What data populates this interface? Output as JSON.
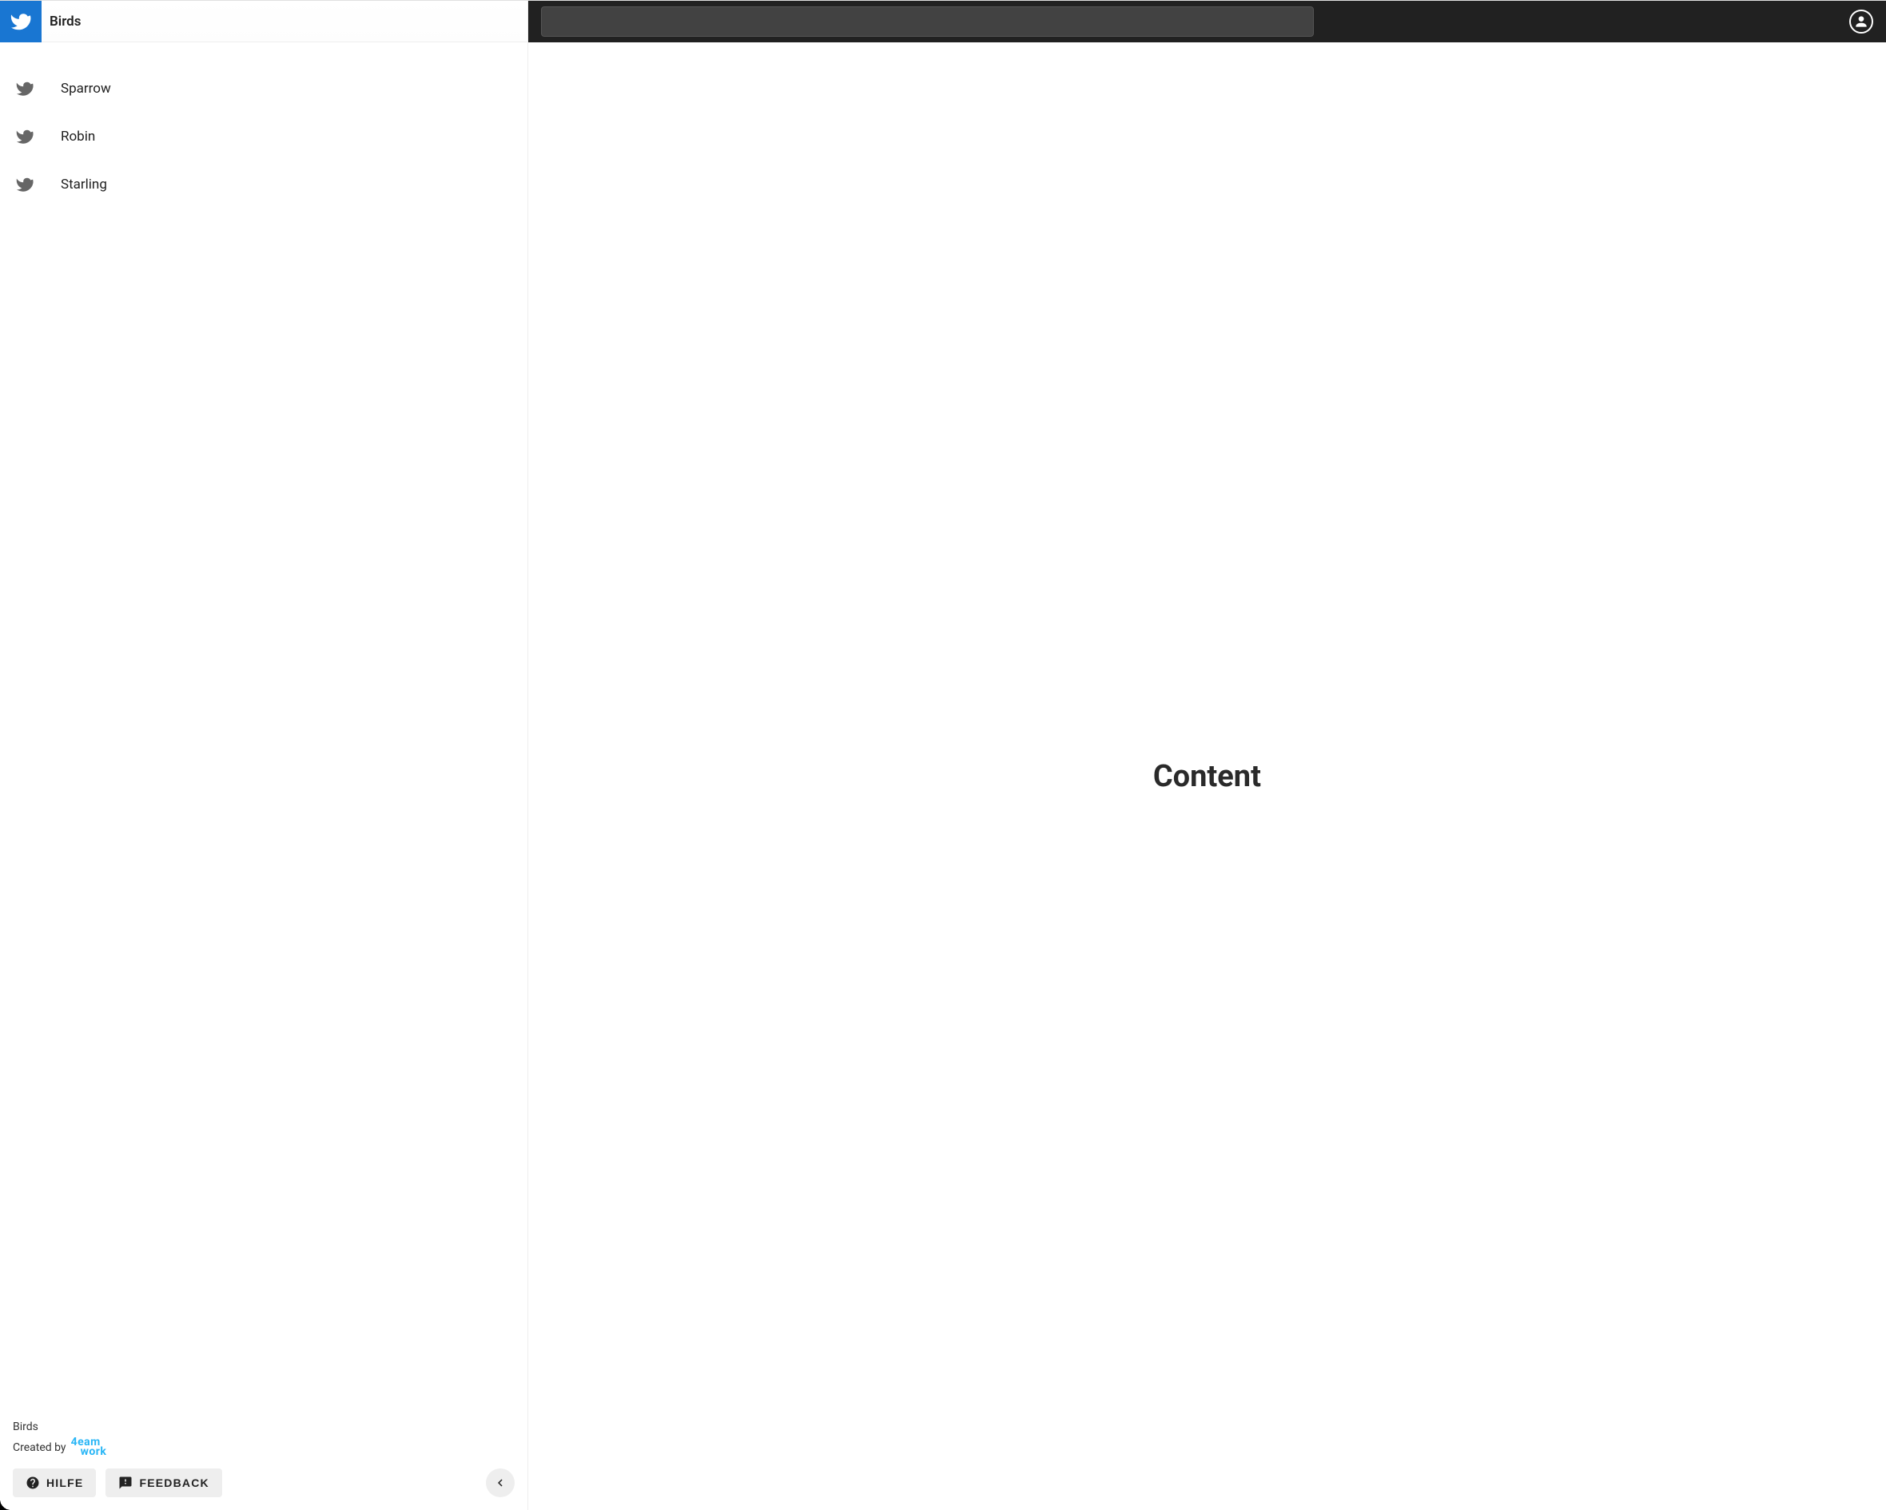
{
  "app": {
    "title": "Birds"
  },
  "sidebar": {
    "items": [
      {
        "label": "Sparrow"
      },
      {
        "label": "Robin"
      },
      {
        "label": "Starling"
      }
    ],
    "footer": {
      "app_name": "Birds",
      "created_by": "Created by",
      "vendor_row1": "eam",
      "vendor_row2": "work",
      "help_label": "HILFE",
      "feedback_label": "FEEDBACK"
    }
  },
  "topbar": {
    "search_placeholder": ""
  },
  "main": {
    "heading": "Content"
  }
}
